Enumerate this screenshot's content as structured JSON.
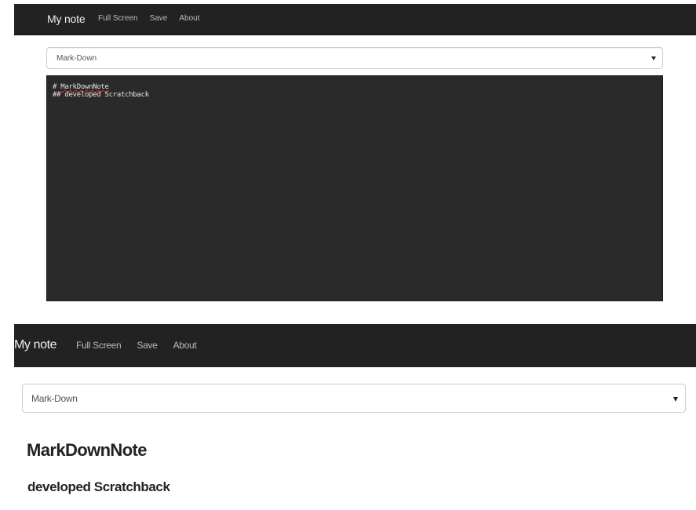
{
  "top": {
    "navbar": {
      "brand": "My note",
      "links": [
        "Full Screen",
        "Save",
        "About"
      ]
    },
    "mode_select": {
      "selected": "Mark-Down"
    },
    "editor": {
      "line1_prefix": "# ",
      "line1_word": "MarkDownNote",
      "line2": "## developed Scratchback"
    }
  },
  "bottom": {
    "navbar": {
      "brand": "My note",
      "links": [
        "Full Screen",
        "Save",
        "About"
      ]
    },
    "mode_select": {
      "selected": "Mark-Down"
    },
    "preview": {
      "h1": "MarkDownNote",
      "h2": "developed Scratchback"
    }
  },
  "colors": {
    "navbar_bg": "#222222",
    "editor_bg": "#2a2a2a",
    "spellcheck_underline": "#d03030"
  }
}
